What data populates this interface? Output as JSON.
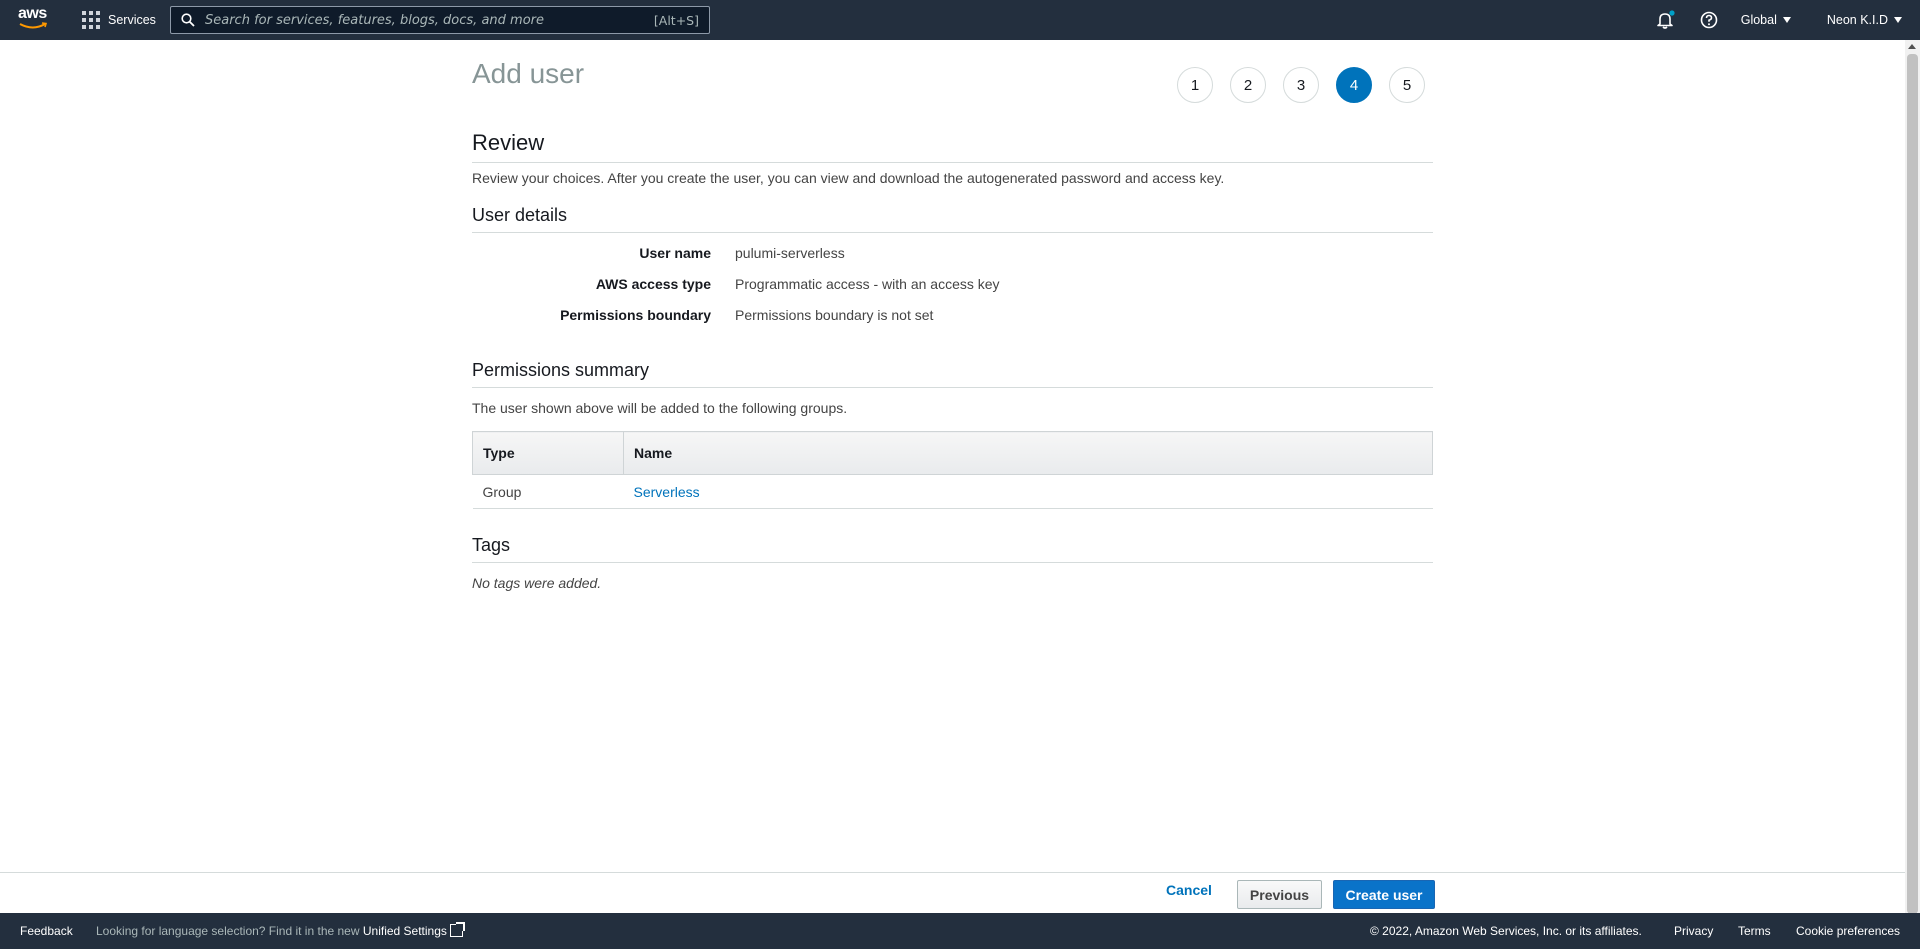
{
  "nav": {
    "logo_text": "aws",
    "services_label": "Services",
    "search_placeholder": "Search for services, features, blogs, docs, and more",
    "search_shortcut": "[Alt+S]",
    "region_label": "Global",
    "account_label": "Neon K.I.D",
    "icons": [
      "grid-icon",
      "search-icon",
      "bell-icon",
      "help-icon",
      "caret-down-icon"
    ]
  },
  "page": {
    "title": "Add user",
    "steps": [
      "1",
      "2",
      "3",
      "4",
      "5"
    ],
    "current_step": "4"
  },
  "review": {
    "heading": "Review",
    "description": "Review your choices. After you create the user, you can view and download the autogenerated password and access key."
  },
  "user_details": {
    "heading": "User details",
    "rows": [
      {
        "label": "User name",
        "value": "pulumi-serverless"
      },
      {
        "label": "AWS access type",
        "value": "Programmatic access - with an access key"
      },
      {
        "label": "Permissions boundary",
        "value": "Permissions boundary is not set"
      }
    ]
  },
  "permissions": {
    "heading": "Permissions summary",
    "description": "The user shown above will be added to the following groups.",
    "columns": [
      "Type",
      "Name"
    ],
    "rows": [
      {
        "type": "Group",
        "name": "Serverless"
      }
    ]
  },
  "tags": {
    "heading": "Tags",
    "empty_text": "No tags were added."
  },
  "actions": {
    "cancel": "Cancel",
    "previous": "Previous",
    "create": "Create user"
  },
  "footer": {
    "feedback": "Feedback",
    "language_text": "Looking for language selection? Find it in the new",
    "unified_settings": "Unified Settings",
    "copyright": "© 2022, Amazon Web Services, Inc. or its affiliates.",
    "privacy": "Privacy",
    "terms": "Terms",
    "cookies": "Cookie preferences"
  },
  "colors": {
    "nav_bg": "#232f3e",
    "accent": "#0073bb",
    "primary_button": "#0a73c9",
    "notification_dot": "#00a1c9"
  }
}
